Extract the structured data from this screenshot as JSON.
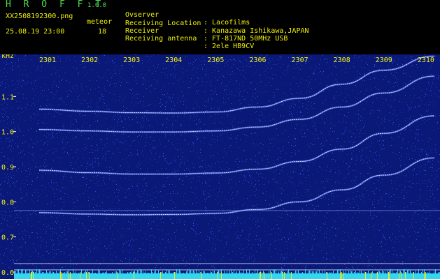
{
  "header": {
    "app_name": "H R O F F T",
    "version": "1.0.0",
    "file_name": "XX2508192300.png",
    "meteor_label": "meteor",
    "datetime": "25.08.19 23:00",
    "meteor_count": "18",
    "info": [
      {
        "label": "Ovserver",
        "value": ": Lacofilms"
      },
      {
        "label": "Receiving Location",
        "value": ": Kanazawa Ishikawa,JAPAN"
      },
      {
        "label": "Receiver",
        "value": ": FT-817ND 50MHz USB"
      },
      {
        "label": "Receiving antenna",
        "value": ": 2ele HB9CV"
      }
    ]
  },
  "spectrogram": {
    "y_unit": "kHz",
    "y_ticks": [
      "1.1",
      "1.0",
      "0.9",
      "0.8",
      "0.7",
      "0.6"
    ],
    "x_ticks": [
      "2301",
      "2302",
      "2303",
      "2304",
      "2305",
      "2306",
      "2307",
      "2308",
      "2309",
      "2310"
    ],
    "colors": {
      "background": "#0a1878",
      "noise": "#3a5cff",
      "trace": "#c8d8ff",
      "grid": "#ffffff",
      "tick_text": "#f2f20a",
      "bottom_band": "#33d6f0"
    }
  },
  "chart_data": {
    "type": "line",
    "title": "",
    "xlabel": "",
    "ylabel": "kHz",
    "x_ticks": [
      "2301",
      "2302",
      "2303",
      "2304",
      "2305",
      "2306",
      "2307",
      "2308",
      "2309",
      "2310"
    ],
    "ylim": [
      0.58,
      1.22
    ],
    "series": [
      {
        "x": [
          2300.8,
          2302.0,
          2303.0,
          2304.0,
          2305.0,
          2306.0,
          2307.0,
          2308.0,
          2309.0,
          2310.2
        ],
        "values": [
          1.064,
          1.058,
          1.054,
          1.053,
          1.056,
          1.07,
          1.095,
          1.135,
          1.175,
          1.215
        ]
      },
      {
        "x": [
          2300.8,
          2302.0,
          2303.0,
          2304.0,
          2305.0,
          2306.0,
          2307.0,
          2308.0,
          2309.0,
          2310.2
        ],
        "values": [
          1.006,
          1.002,
          0.999,
          0.999,
          1.002,
          1.013,
          1.035,
          1.07,
          1.11,
          1.158
        ]
      },
      {
        "x": [
          2300.8,
          2302.0,
          2303.0,
          2304.0,
          2305.0,
          2306.0,
          2307.0,
          2308.0,
          2309.0,
          2310.2
        ],
        "values": [
          0.89,
          0.883,
          0.879,
          0.879,
          0.882,
          0.893,
          0.915,
          0.95,
          0.995,
          1.045
        ]
      },
      {
        "x": [
          2300.8,
          2302.0,
          2303.0,
          2304.0,
          2305.0,
          2306.0,
          2307.0,
          2308.0,
          2309.0,
          2310.2
        ],
        "values": [
          0.769,
          0.765,
          0.763,
          0.764,
          0.767,
          0.778,
          0.8,
          0.834,
          0.876,
          0.925
        ]
      }
    ],
    "horizontal_lines": [
      0.775,
      0.624,
      0.606
    ]
  }
}
